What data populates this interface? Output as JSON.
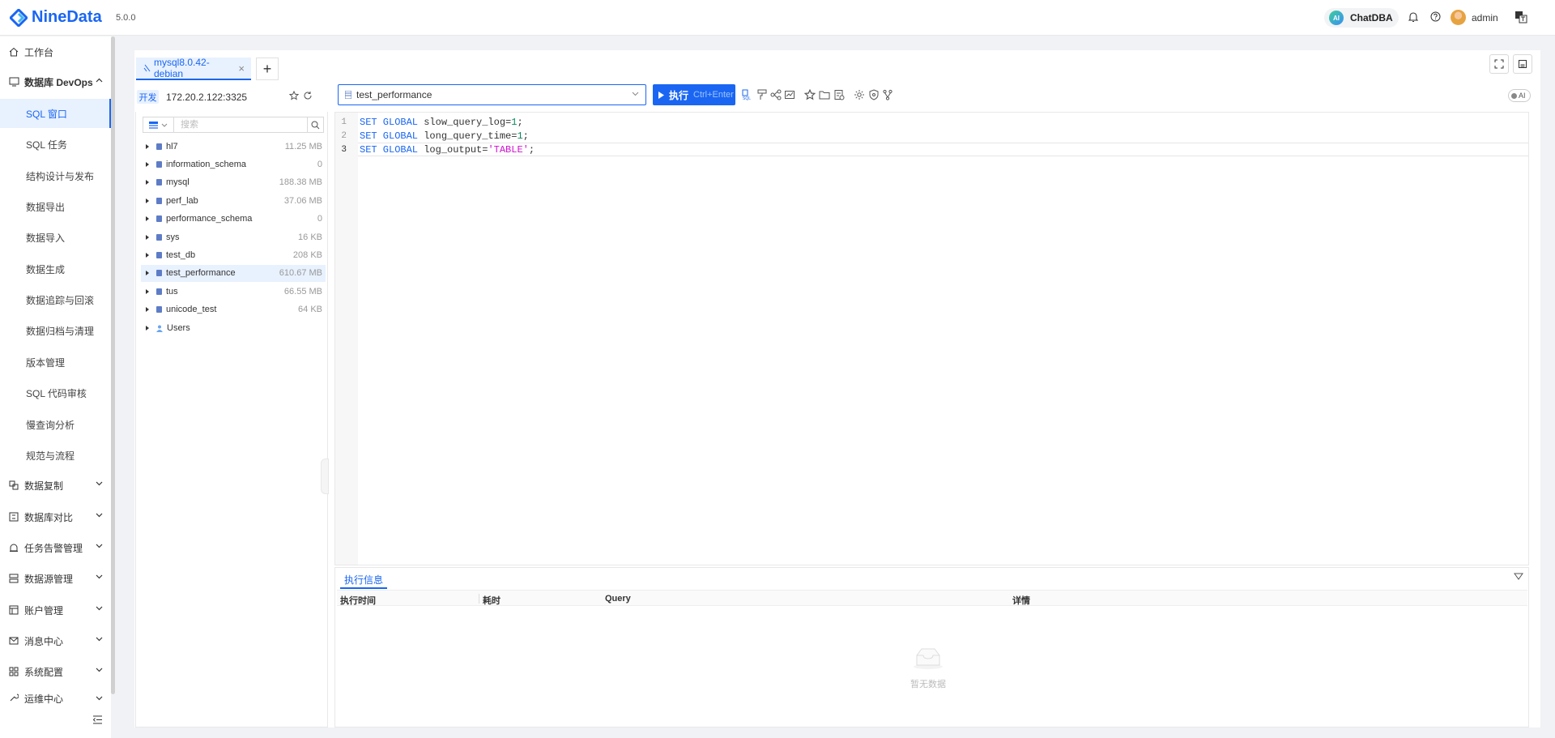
{
  "app": {
    "name": "NineData",
    "version": "5.0.0"
  },
  "topbar": {
    "chatdba": "ChatDBA",
    "ai_badge": "AI",
    "username": "admin"
  },
  "sidebar": {
    "workbench": "工作台",
    "devops": "数据库 DevOps",
    "sub_items": [
      "SQL 窗口",
      "SQL 任务",
      "结构设计与发布",
      "数据导出",
      "数据导入",
      "数据生成",
      "数据追踪与回滚",
      "数据归档与清理",
      "版本管理",
      "SQL 代码审核",
      "慢查询分析",
      "规范与流程"
    ],
    "groups": [
      "数据复制",
      "数据库对比",
      "任务告警管理",
      "数据源管理",
      "账户管理",
      "消息中心",
      "系统配置",
      "运维中心"
    ]
  },
  "tab": {
    "label": "mysql8.0.42-debian"
  },
  "connection": {
    "env": "开发",
    "address": "172.20.2.122:3325"
  },
  "tree": {
    "search_placeholder": "搜索",
    "items": [
      {
        "name": "hl7",
        "size": "11.25 MB"
      },
      {
        "name": "information_schema",
        "size": "0"
      },
      {
        "name": "mysql",
        "size": "188.38 MB"
      },
      {
        "name": "perf_lab",
        "size": "37.06 MB"
      },
      {
        "name": "performance_schema",
        "size": "0"
      },
      {
        "name": "sys",
        "size": "16 KB"
      },
      {
        "name": "test_db",
        "size": "208 KB"
      },
      {
        "name": "test_performance",
        "size": "610.67 MB"
      },
      {
        "name": "tus",
        "size": "66.55 MB"
      },
      {
        "name": "unicode_test",
        "size": "64 KB"
      },
      {
        "name": "Users",
        "size": ""
      }
    ],
    "selected": "test_performance"
  },
  "editor": {
    "database": "test_performance",
    "run_label": "执行",
    "run_shortcut": "Ctrl+Enter",
    "ai_toggle": "AI",
    "lines": [
      {
        "n": "1",
        "kw": "SET GLOBAL",
        "rest": " slow_query_log=",
        "val": "1",
        "end": ";"
      },
      {
        "n": "2",
        "kw": "SET GLOBAL",
        "rest": " long_query_time=",
        "val": "1",
        "end": ";"
      },
      {
        "n": "3",
        "kw": "SET GLOBAL",
        "rest": " log_output=",
        "val": "'TABLE'",
        "end": ";"
      }
    ]
  },
  "result": {
    "tab": "执行信息",
    "columns": [
      "执行时间",
      "耗时",
      "Query",
      "详情"
    ],
    "empty_text": "暂无数据"
  }
}
